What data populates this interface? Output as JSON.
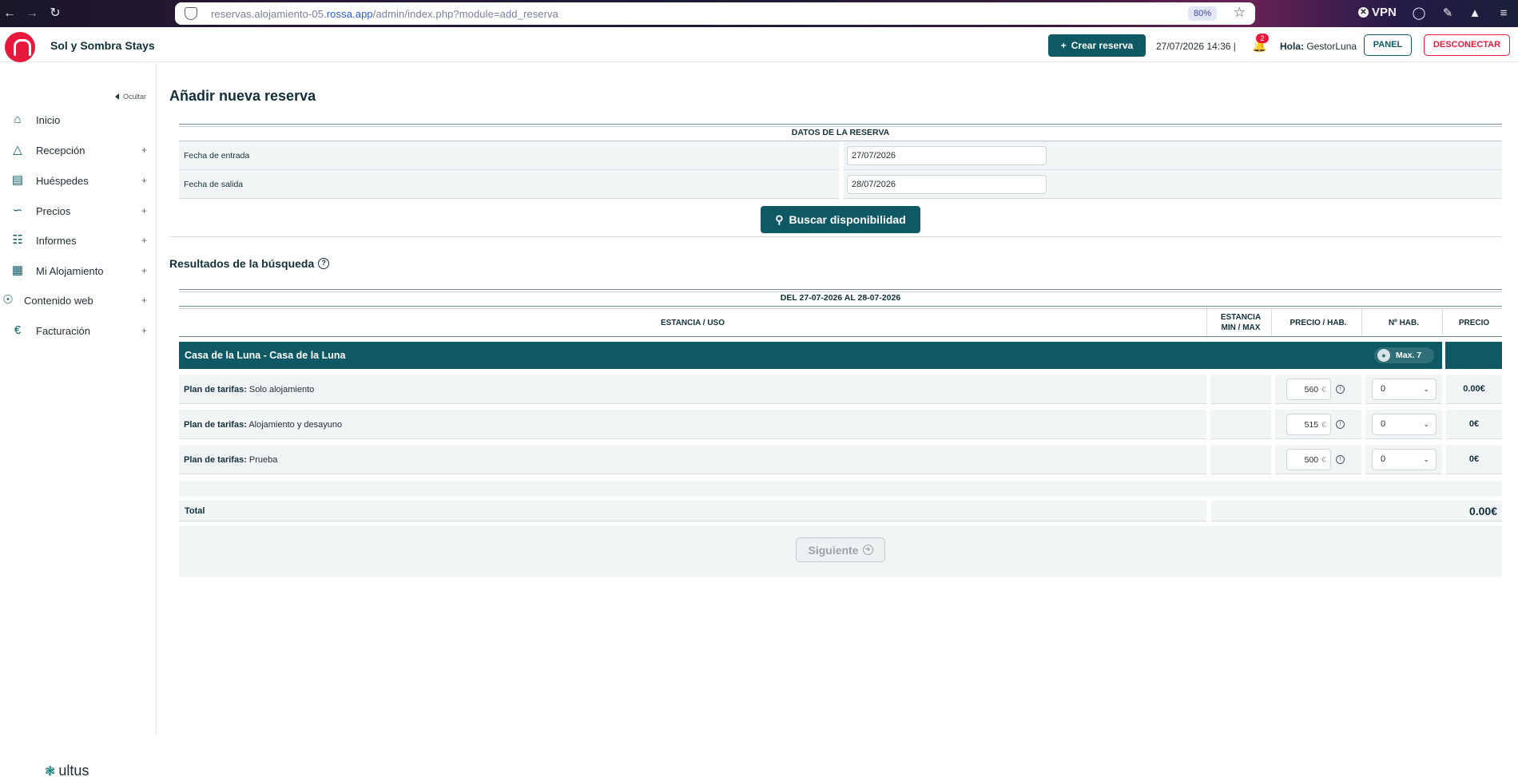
{
  "browser": {
    "url_prefix": "reservas.alojamiento-05.",
    "url_domain": "rossa.app",
    "url_path": "/admin/index.php?module=add_reserva",
    "zoom": "80%",
    "vpn_label": "VPN"
  },
  "header": {
    "brand": "Sol y Sombra Stays",
    "create_button": "Crear reserva",
    "datetime": "27/07/2026 14:36 |",
    "notifications_count": "2",
    "greeting": "Hola:",
    "username": "GestorLuna",
    "panel_button": "PANEL",
    "logout_button": "DESCONECTAR",
    "brand_color": "#0e5963",
    "accent_color": "#e8193c"
  },
  "sidebar": {
    "hide_label": "Ocultar",
    "items": [
      {
        "label": "Inicio",
        "icon": "home-icon",
        "plus": ""
      },
      {
        "label": "Recepción",
        "icon": "bell-desk-icon",
        "plus": "+"
      },
      {
        "label": "Huéspedes",
        "icon": "luggage-icon",
        "plus": "+"
      },
      {
        "label": "Precios",
        "icon": "chart-icon",
        "plus": "+"
      },
      {
        "label": "Informes",
        "icon": "scroll-icon",
        "plus": "+"
      },
      {
        "label": "Mi Alojamiento",
        "icon": "building-icon",
        "plus": "+"
      },
      {
        "label": "Contenido web",
        "icon": "globe-icon",
        "plus": "+"
      },
      {
        "label": "Facturación",
        "icon": "invoice-icon",
        "plus": "+"
      }
    ],
    "footer_logo": "ultus"
  },
  "main": {
    "title": "Añadir nueva reserva",
    "form": {
      "header": "DATOS DE LA RESERVA",
      "checkin_label": "Fecha de entrada",
      "checkin_value": "27/07/2026",
      "checkout_label": "Fecha de salida",
      "checkout_value": "28/07/2026"
    },
    "search_button": "Buscar disponibilidad",
    "results_title": "Resultados de la búsqueda",
    "results": {
      "range": "DEL 27-07-2026 AL 28-07-2026",
      "columns": {
        "stay": "ESTANCIA / USO",
        "minmax_1": "ESTANCIA",
        "minmax_2": "MIN / MAX",
        "price_room": "PRECIO / HAB.",
        "rooms": "Nº HAB.",
        "price": "PRECIO"
      },
      "property": {
        "name": "Casa de la Luna - Casa de la Luna",
        "max": "Max. 7"
      },
      "rate_label_prefix": "Plan de tarifas:",
      "rates": [
        {
          "name": "Solo alojamiento",
          "price_room": "560",
          "currency": "€",
          "rooms": "0",
          "price": "0.00€"
        },
        {
          "name": "Alojamiento y desayuno",
          "price_room": "515",
          "currency": "€",
          "rooms": "0",
          "price": "0€"
        },
        {
          "name": "Prueba",
          "price_room": "500",
          "currency": "€",
          "rooms": "0",
          "price": "0€"
        }
      ],
      "total_label": "Total",
      "total_value": "0.00€"
    },
    "next_button": "Siguiente"
  }
}
